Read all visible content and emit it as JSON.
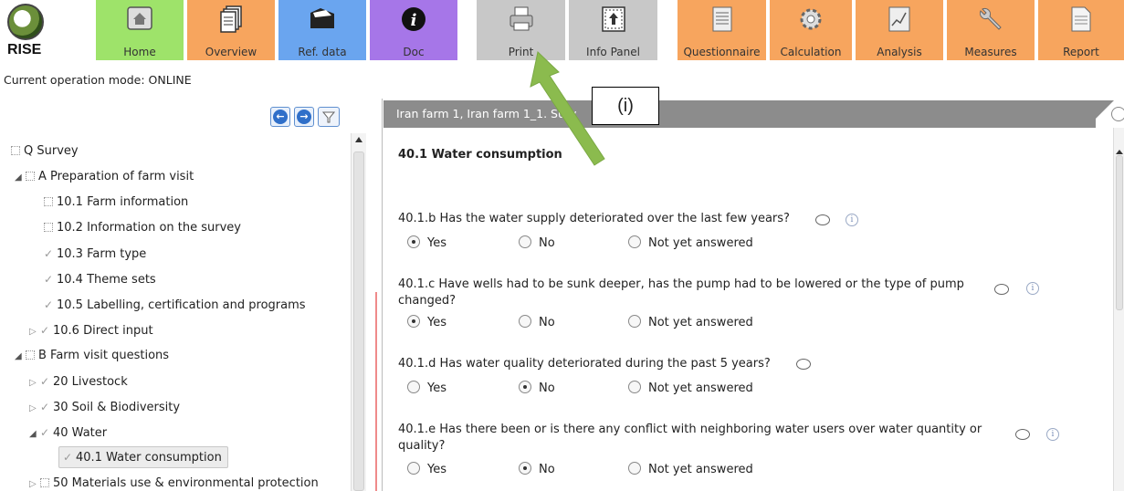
{
  "toolbar": {
    "logo_text": "RISE",
    "buttons": [
      {
        "label": "Home",
        "icon": "home-icon"
      },
      {
        "label": "Overview",
        "icon": "documents-icon"
      },
      {
        "label": "Ref. data",
        "icon": "folder-icon"
      },
      {
        "label": "Doc",
        "icon": "info-icon"
      },
      {
        "label": "Print",
        "icon": "printer-icon"
      },
      {
        "label": "Info Panel",
        "icon": "info-panel-icon"
      },
      {
        "label": "Questionnaire",
        "icon": "questionnaire-icon"
      },
      {
        "label": "Calculation",
        "icon": "gear-icon"
      },
      {
        "label": "Analysis",
        "icon": "chart-icon"
      },
      {
        "label": "Measures",
        "icon": "wrench-icon"
      },
      {
        "label": "Report",
        "icon": "report-icon"
      }
    ],
    "colors": {
      "green": "#9ee36a",
      "orange": "#f7a55e",
      "blue": "#6aa5ef",
      "purple": "#a676e8",
      "gray": "#c8c8c8"
    }
  },
  "mode_text": "Current operation mode: ONLINE",
  "tree": [
    {
      "label": "Q Survey"
    },
    {
      "label": "A Preparation of farm visit"
    },
    {
      "label": "10.1 Farm information"
    },
    {
      "label": "10.2 Information on the survey"
    },
    {
      "label": "10.3 Farm type"
    },
    {
      "label": "10.4 Theme sets"
    },
    {
      "label": "10.5 Labelling, certification and programs"
    },
    {
      "label": "10.6 Direct input"
    },
    {
      "label": "B Farm visit questions"
    },
    {
      "label": "20 Livestock"
    },
    {
      "label": "30 Soil & Biodiversity"
    },
    {
      "label": "40 Water"
    },
    {
      "label": "40.1 Water consumption"
    },
    {
      "label": "50 Materials use & environmental protection"
    }
  ],
  "header": {
    "title": "Iran farm 1, Iran farm 1_1. Surv"
  },
  "callout": "(i)",
  "section_title": "40.1  Water consumption",
  "options": {
    "yes": "Yes",
    "no": "No",
    "na": "Not yet answered"
  },
  "questions": [
    {
      "text": "40.1.b Has the water supply deteriorated over the last few years?",
      "answer": "yes"
    },
    {
      "text": "40.1.c Have wells had to be sunk deeper, has the pump had to be lowered or the type of pump changed?",
      "answer": "yes"
    },
    {
      "text": "40.1.d Has water quality deteriorated during the past 5 years?",
      "answer": "no"
    },
    {
      "text": "40.1.e Has there been or is there any conflict with neighboring water users over water quantity or quality?",
      "answer": "no"
    }
  ]
}
